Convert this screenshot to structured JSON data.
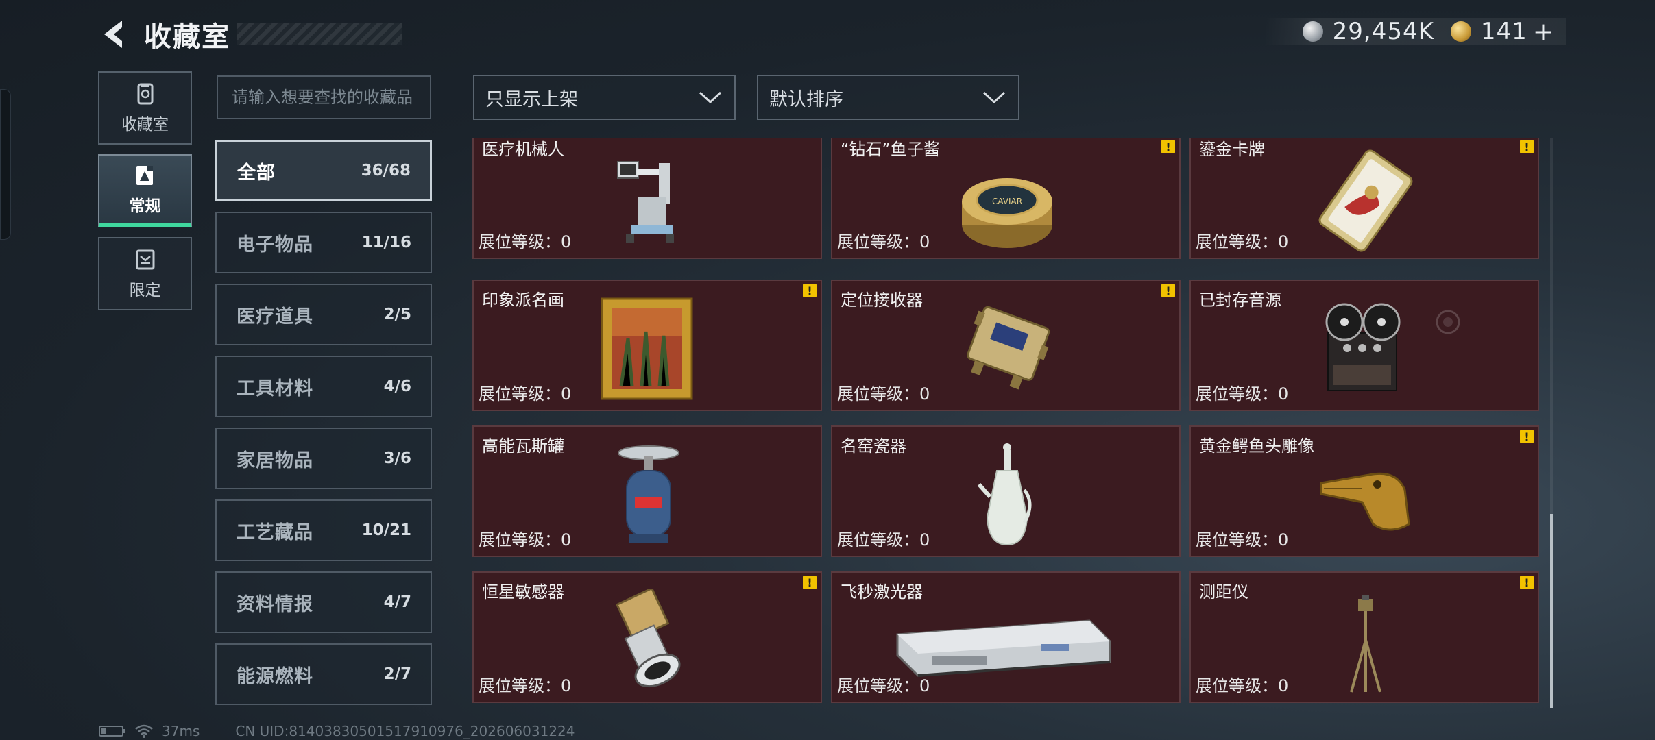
{
  "header": {
    "title": "收藏室"
  },
  "currency": {
    "silver_value": "29,454K",
    "gold_value": "141",
    "plus": "+"
  },
  "left_nav": [
    {
      "label": "收藏室",
      "icon": "vault-icon"
    },
    {
      "label": "常规",
      "icon": "regular-icon",
      "active": true
    },
    {
      "label": "限定",
      "icon": "limited-icon"
    }
  ],
  "search": {
    "placeholder": "请输入想要查找的收藏品"
  },
  "filters": {
    "shelf_filter": "只显示上架",
    "sort": "默认排序"
  },
  "categories": [
    {
      "name": "全部",
      "count": "36/68"
    },
    {
      "name": "电子物品",
      "count": "11/16"
    },
    {
      "name": "医疗道具",
      "count": "2/5"
    },
    {
      "name": "工具材料",
      "count": "4/6"
    },
    {
      "name": "家居物品",
      "count": "3/6"
    },
    {
      "name": "工艺藏品",
      "count": "10/21"
    },
    {
      "name": "资料情报",
      "count": "4/7"
    },
    {
      "name": "能源燃料",
      "count": "2/7"
    }
  ],
  "level_label": "展位等级：0",
  "warn_glyph": "!",
  "items": [
    {
      "name": "医疗机械人",
      "icon": "medical-robot-icon",
      "warn": false
    },
    {
      "name": "“钻石”鱼子酱",
      "icon": "caviar-tin-icon",
      "warn": true
    },
    {
      "name": "鎏金卡牌",
      "icon": "gilded-card-icon",
      "warn": true
    },
    {
      "name": "印象派名画",
      "icon": "framed-painting-icon",
      "warn": true
    },
    {
      "name": "定位接收器",
      "icon": "locator-receiver-icon",
      "warn": true
    },
    {
      "name": "已封存音源",
      "icon": "reel-recorder-icon",
      "warn": false
    },
    {
      "name": "高能瓦斯罐",
      "icon": "gas-canister-icon",
      "warn": false
    },
    {
      "name": "名窑瓷器",
      "icon": "porcelain-ewer-icon",
      "warn": false
    },
    {
      "name": "黄金鳄鱼头雕像",
      "icon": "golden-crocodile-icon",
      "warn": true
    },
    {
      "name": "恒星敏感器",
      "icon": "star-sensor-icon",
      "warn": true
    },
    {
      "name": "飞秒激光器",
      "icon": "femtosecond-laser-icon",
      "warn": false
    },
    {
      "name": "测距仪",
      "icon": "rangefinder-tripod-icon",
      "warn": true
    }
  ],
  "status": {
    "ping": "37ms",
    "uid": "CN UID:8140383050151791097​6_202606031224"
  }
}
